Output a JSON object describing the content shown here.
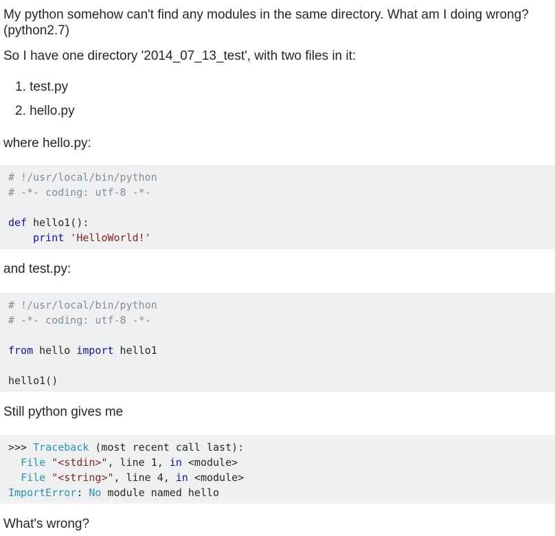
{
  "question": {
    "intro_line1": "My python somehow can't find any modules in the same directory. What am I doing wrong?",
    "intro_line2": "(python2.7)",
    "setup": "So I have one directory '2014_07_13_test', with two files in it:",
    "files": [
      "1. test.py",
      "2. hello.py"
    ],
    "where_hello": "where hello.py:",
    "hello_code": {
      "line1": "# !/usr/local/bin/python",
      "line2": "# -*- coding: utf-8 -*-",
      "def_kw": "def",
      "def_rest": " hello1():",
      "print_kw": "    print",
      "print_str": "'HelloWorld!'"
    },
    "and_test": "and test.py:",
    "test_code": {
      "line1": "# !/usr/local/bin/python",
      "line2": "# -*- coding: utf-8 -*-",
      "from_kw": "from",
      "module": " hello ",
      "import_kw": "import",
      "name": " hello1",
      "call": "hello1()"
    },
    "still": "Still python gives me",
    "traceback": {
      "prompt": ">>> ",
      "traceback": "Traceback",
      "tb_rest": " (most recent call last):",
      "file_kw": "File",
      "stdin_str": "\"<stdin>\"",
      "line1_rest": ", line 1, ",
      "in_kw": "in",
      "module1": " <module>",
      "string_str": "\"<string>\"",
      "line4_rest": ", line 4, ",
      "error_type": "ImportError",
      "colon": ": ",
      "no_kw": "No",
      "error_rest": " module named hello"
    },
    "closing": "What's wrong?"
  }
}
